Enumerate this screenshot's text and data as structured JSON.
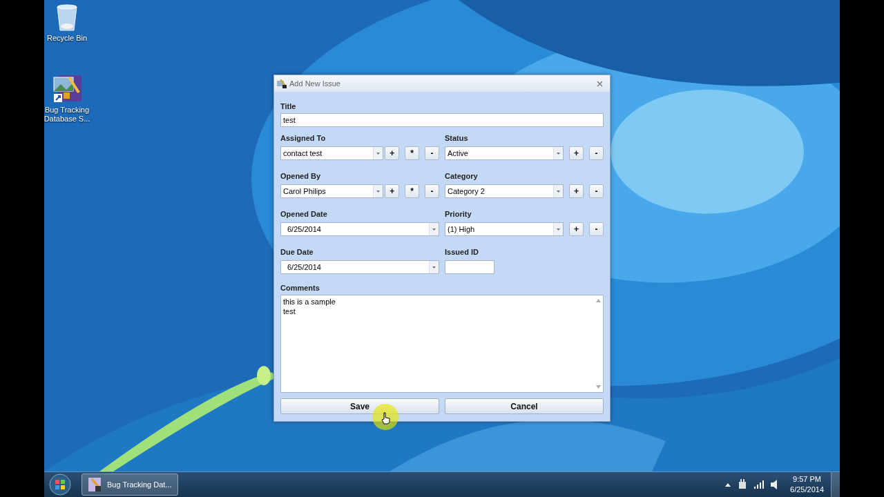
{
  "desktop_icons": [
    {
      "kind": "recycle",
      "label": "Recycle Bin"
    },
    {
      "kind": "app",
      "label": "Bug Tracking Database S..."
    }
  ],
  "dialog": {
    "title": "Add New Issue",
    "title_field": {
      "label": "Title",
      "value": "test"
    },
    "rows": [
      {
        "left": {
          "kind": "combo",
          "label": "Assigned To",
          "value": "contact test",
          "buttons": [
            "+",
            "*",
            "-"
          ]
        },
        "right": {
          "kind": "combo",
          "label": "Status",
          "value": "Active",
          "buttons": [
            "+",
            "-"
          ]
        }
      },
      {
        "left": {
          "kind": "combo",
          "label": "Opened By",
          "value": "Carol Philips",
          "buttons": [
            "+",
            "*",
            "-"
          ]
        },
        "right": {
          "kind": "combo",
          "label": "Category",
          "value": "Category 2",
          "buttons": [
            "+",
            "-"
          ]
        }
      },
      {
        "left": {
          "kind": "date",
          "label": "Opened Date",
          "value": "6/25/2014"
        },
        "right": {
          "kind": "combo",
          "label": "Priority",
          "value": "(1) High",
          "buttons": [
            "+",
            "-"
          ]
        }
      },
      {
        "left": {
          "kind": "date",
          "label": "Due Date",
          "value": "6/25/2014"
        },
        "right": {
          "kind": "input",
          "label": "Issued ID"
        }
      }
    ],
    "comments": {
      "label": "Comments",
      "lines": [
        "this is a sample",
        "test"
      ]
    },
    "buttons": [
      "Save",
      "Cancel"
    ]
  },
  "taskbar": {
    "task": "Bug Tracking Dat...",
    "time": "9:57 PM",
    "date": "6/25/2014"
  }
}
